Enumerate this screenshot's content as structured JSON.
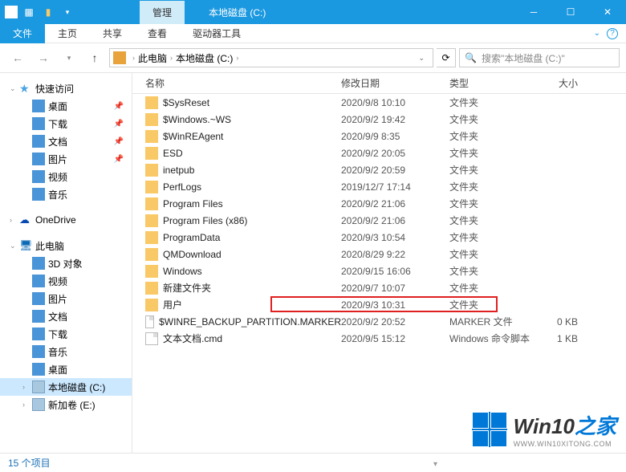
{
  "title_tab": "管理",
  "window_title": "本地磁盘 (C:)",
  "ribbon": {
    "file": "文件",
    "home": "主页",
    "share": "共享",
    "view": "查看",
    "drive": "驱动器工具"
  },
  "address": {
    "root": "此电脑",
    "drive": "本地磁盘 (C:)"
  },
  "search_placeholder": "搜索\"本地磁盘 (C:)\"",
  "sidebar": {
    "quick": "快速访问",
    "quick_items": [
      {
        "label": "桌面",
        "icon": "ti-blue",
        "pin": true
      },
      {
        "label": "下载",
        "icon": "ti-blue",
        "pin": true
      },
      {
        "label": "文档",
        "icon": "ti-blue",
        "pin": true
      },
      {
        "label": "图片",
        "icon": "ti-blue",
        "pin": true
      },
      {
        "label": "视频",
        "icon": "ti-blue",
        "pin": false
      },
      {
        "label": "音乐",
        "icon": "ti-blue",
        "pin": false
      }
    ],
    "onedrive": "OneDrive",
    "thispc": "此电脑",
    "pc_items": [
      {
        "label": "3D 对象"
      },
      {
        "label": "视频"
      },
      {
        "label": "图片"
      },
      {
        "label": "文档"
      },
      {
        "label": "下载"
      },
      {
        "label": "音乐"
      },
      {
        "label": "桌面"
      },
      {
        "label": "本地磁盘 (C:)",
        "drive": true,
        "selected": true
      },
      {
        "label": "新加卷 (E:)",
        "drive": true
      }
    ]
  },
  "columns": {
    "name": "名称",
    "date": "修改日期",
    "type": "类型",
    "size": "大小"
  },
  "files": [
    {
      "name": "$SysReset",
      "date": "2020/9/8 10:10",
      "type": "文件夹",
      "size": "",
      "folder": true
    },
    {
      "name": "$Windows.~WS",
      "date": "2020/9/2 19:42",
      "type": "文件夹",
      "size": "",
      "folder": true
    },
    {
      "name": "$WinREAgent",
      "date": "2020/9/9 8:35",
      "type": "文件夹",
      "size": "",
      "folder": true
    },
    {
      "name": "ESD",
      "date": "2020/9/2 20:05",
      "type": "文件夹",
      "size": "",
      "folder": true
    },
    {
      "name": "inetpub",
      "date": "2020/9/2 20:59",
      "type": "文件夹",
      "size": "",
      "folder": true
    },
    {
      "name": "PerfLogs",
      "date": "2019/12/7 17:14",
      "type": "文件夹",
      "size": "",
      "folder": true
    },
    {
      "name": "Program Files",
      "date": "2020/9/2 21:06",
      "type": "文件夹",
      "size": "",
      "folder": true
    },
    {
      "name": "Program Files (x86)",
      "date": "2020/9/2 21:06",
      "type": "文件夹",
      "size": "",
      "folder": true
    },
    {
      "name": "ProgramData",
      "date": "2020/9/3 10:54",
      "type": "文件夹",
      "size": "",
      "folder": true
    },
    {
      "name": "QMDownload",
      "date": "2020/8/29 9:22",
      "type": "文件夹",
      "size": "",
      "folder": true
    },
    {
      "name": "Windows",
      "date": "2020/9/15 16:06",
      "type": "文件夹",
      "size": "",
      "folder": true
    },
    {
      "name": "新建文件夹",
      "date": "2020/9/7 10:07",
      "type": "文件夹",
      "size": "",
      "folder": true
    },
    {
      "name": "用户",
      "date": "2020/9/3 10:31",
      "type": "文件夹",
      "size": "",
      "folder": true,
      "highlight": true
    },
    {
      "name": "$WINRE_BACKUP_PARTITION.MARKER",
      "date": "2020/9/2 20:52",
      "type": "MARKER 文件",
      "size": "0 KB",
      "folder": false
    },
    {
      "name": "文本文档.cmd",
      "date": "2020/9/5 15:12",
      "type": "Windows 命令脚本",
      "size": "1 KB",
      "folder": false
    }
  ],
  "status": "15 个项目",
  "watermark": {
    "brand": "Win10",
    "suffix": "之家",
    "url": "WWW.WIN10XITONG.COM"
  }
}
